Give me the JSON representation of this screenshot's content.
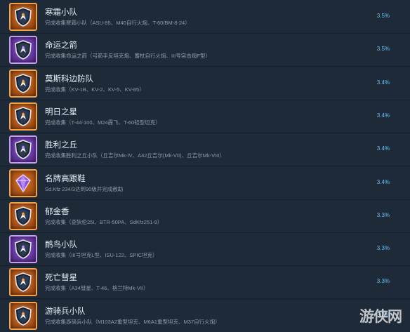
{
  "achievements": [
    {
      "title": "寒霜小队",
      "description": "完成收集寒霜小队（ASU-85、M40自行火炮、T-60/BM-8-24）",
      "percent": "3.5%",
      "badge": "orange",
      "icon": "shield-emblem-icon"
    },
    {
      "title": "命运之箭",
      "description": "完成收集命运之箭（弓箭手反坦克炮、蓄杖自行火炮、III号突击炮F型）",
      "percent": "3.5%",
      "badge": "purple",
      "icon": "shield-emblem-icon"
    },
    {
      "title": "莫斯科边防队",
      "description": "完成收集（KV-1B、KV-2、KV-5、KV-85）",
      "percent": "3.4%",
      "badge": "orange",
      "icon": "shield-emblem-icon"
    },
    {
      "title": "明日之星",
      "description": "完成收集（T-44-100、M24霞飞、T-60轻型坦克）",
      "percent": "3.4%",
      "badge": "orange",
      "icon": "shield-emblem-icon"
    },
    {
      "title": "胜利之丘",
      "description": "完成收集胜利之丘小队（丘吉尔Mk-IV、A42丘吉尔(Mk-VII)、丘吉尔Mk-VIII）",
      "percent": "3.4%",
      "badge": "purple",
      "icon": "shield-emblem-icon"
    },
    {
      "title": "名牌高跟鞋",
      "description": "Sd.Kfz 234/3达到90级并完成赦助",
      "percent": "3.4%",
      "badge": "orange",
      "icon": "gem-icon"
    },
    {
      "title": "郁金香",
      "description": "完成收集（查狄伦25I、BTR-50PA、SdKfz251-9）",
      "percent": "3.3%",
      "badge": "orange",
      "icon": "shield-emblem-icon"
    },
    {
      "title": "鸸鸟小队",
      "description": "完成收集（III号坦克L型、ISU-122、SPIC坦克）",
      "percent": "3.3%",
      "badge": "purple",
      "icon": "shield-emblem-icon"
    },
    {
      "title": "死亡彗星",
      "description": "完成收集（A34彗星、T-46、格兰特Mk-VII）",
      "percent": "3.3%",
      "badge": "orange",
      "icon": "shield-emblem-icon"
    },
    {
      "title": "游骑兵小队",
      "description": "完成收集游骑兵小队（M103A2重型坦克、M6A1重型坦克、M37自行火炮）",
      "percent": "3.3%",
      "badge": "orange",
      "icon": "shield-emblem-icon"
    }
  ],
  "colors": {
    "background": "#1b2838",
    "row": "#1e2a38",
    "percent": "#66c0f4",
    "badge_orange": "#c0651f",
    "badge_purple": "#7a48b8"
  },
  "watermark": {
    "text": "游侠网",
    "icon": "gamersky-logo-icon"
  }
}
